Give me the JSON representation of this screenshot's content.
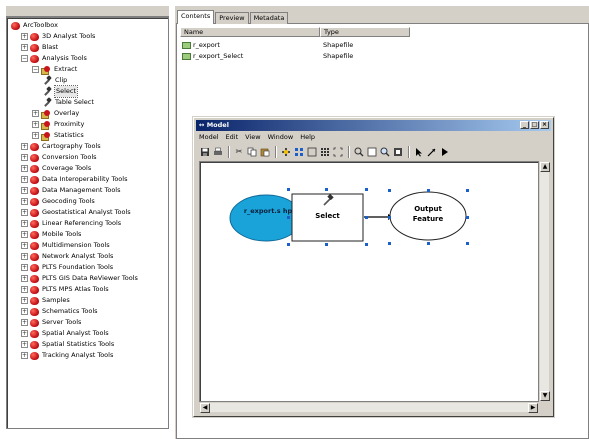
{
  "tree": {
    "root": "ArcToolbox",
    "items": [
      {
        "label": "3D Analyst Tools",
        "kind": "toolbox"
      },
      {
        "label": "Blast",
        "kind": "toolbox"
      },
      {
        "label": "Analysis Tools",
        "kind": "toolbox"
      },
      {
        "label": "Extract",
        "kind": "toolset"
      },
      {
        "label": "Clip",
        "kind": "tool"
      },
      {
        "label": "Select",
        "kind": "tool",
        "selected": true
      },
      {
        "label": "Table Select",
        "kind": "tool"
      },
      {
        "label": "Overlay",
        "kind": "toolset"
      },
      {
        "label": "Proximity",
        "kind": "toolset"
      },
      {
        "label": "Statistics",
        "kind": "toolset"
      },
      {
        "label": "Cartography Tools",
        "kind": "toolbox"
      },
      {
        "label": "Conversion Tools",
        "kind": "toolbox"
      },
      {
        "label": "Coverage Tools",
        "kind": "toolbox"
      },
      {
        "label": "Data Interoperability Tools",
        "kind": "toolbox"
      },
      {
        "label": "Data Management Tools",
        "kind": "toolbox"
      },
      {
        "label": "Geocoding Tools",
        "kind": "toolbox"
      },
      {
        "label": "Geostatistical Analyst Tools",
        "kind": "toolbox"
      },
      {
        "label": "Linear Referencing Tools",
        "kind": "toolbox"
      },
      {
        "label": "Mobile Tools",
        "kind": "toolbox"
      },
      {
        "label": "Multidimension Tools",
        "kind": "toolbox"
      },
      {
        "label": "Network Analyst Tools",
        "kind": "toolbox"
      },
      {
        "label": "PLTS Foundation Tools",
        "kind": "toolbox"
      },
      {
        "label": "PLTS GIS Data ReViewer Tools",
        "kind": "toolbox"
      },
      {
        "label": "PLTS MPS Atlas Tools",
        "kind": "toolbox"
      },
      {
        "label": "Samples",
        "kind": "toolbox"
      },
      {
        "label": "Schematics Tools",
        "kind": "toolbox"
      },
      {
        "label": "Server Tools",
        "kind": "toolbox"
      },
      {
        "label": "Spatial Analyst Tools",
        "kind": "toolbox"
      },
      {
        "label": "Spatial Statistics Tools",
        "kind": "toolbox"
      },
      {
        "label": "Tracking Analyst Tools",
        "kind": "toolbox"
      }
    ]
  },
  "catalog": {
    "tabs": [
      "Contents",
      "Preview",
      "Metadata"
    ],
    "active_tab": "Contents",
    "columns": [
      "Name",
      "Type"
    ],
    "rows": [
      {
        "name": "r_export",
        "type": "Shapefile"
      },
      {
        "name": "r_export_Select",
        "type": "Shapefile"
      }
    ]
  },
  "model": {
    "title": "Model",
    "menus": [
      "Model",
      "Edit",
      "View",
      "Window",
      "Help"
    ],
    "toolbar_icons": [
      "save-icon",
      "print-icon",
      "cut-icon",
      "copy-icon",
      "paste-icon",
      "add-data-icon",
      "auto-layout-icon",
      "full-extent-icon",
      "grid-icon",
      "fixed-zoom-icon",
      "zoom-in-icon",
      "zoom-out-icon",
      "pan-icon",
      "select-icon",
      "connect-icon",
      "run-icon"
    ],
    "input_label": "r_export.s hp",
    "tool_label": "Select",
    "output_label": "Output Feature",
    "colors": {
      "input": "#1aa3d9",
      "titlebar": "#0a246a"
    }
  }
}
